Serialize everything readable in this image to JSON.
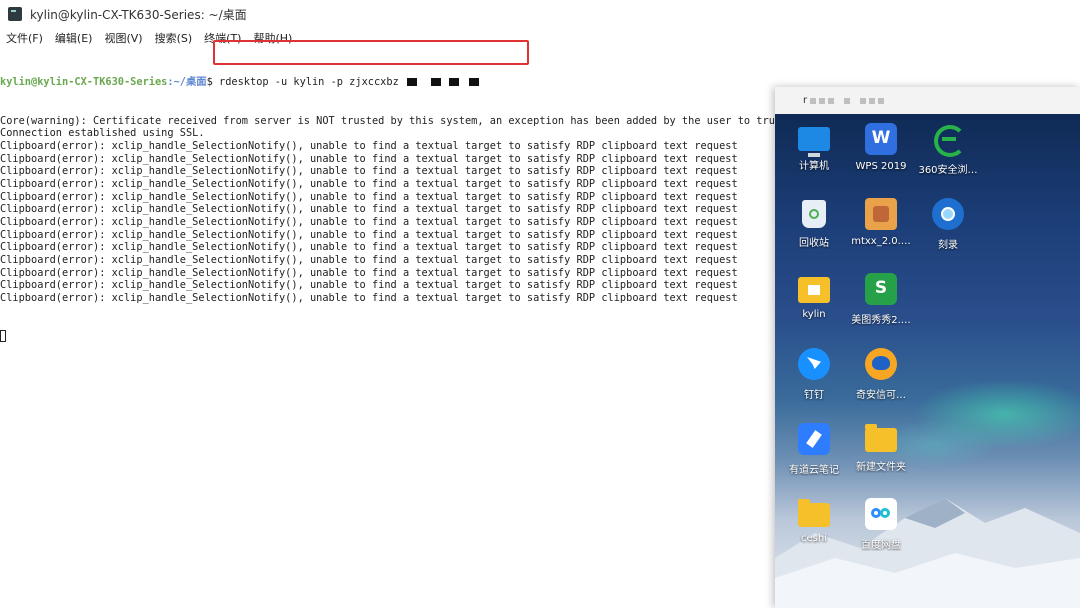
{
  "window": {
    "title": "kylin@kylin-CX-TK630-Series: ~/桌面",
    "menu": [
      "文件(F)",
      "编辑(E)",
      "视图(V)",
      "搜索(S)",
      "终端(T)",
      "帮助(H)"
    ]
  },
  "terminal": {
    "prompt_user": "kylin@kylin-CX-TK630-Series",
    "prompt_path": ":~/桌面",
    "prompt_symbol": "$",
    "command": " rdesktop -u kylin -p zjxccxbz ",
    "command_mask_note": "password partly redacted",
    "lines": [
      "Core(warning): Certificate received from server is NOT trusted by this system, an exception has been added by the user to trust this specific certificate.",
      "Connection established using SSL.",
      "Clipboard(error): xclip_handle_SelectionNotify(), unable to find a textual target to satisfy RDP clipboard text request",
      "Clipboard(error): xclip_handle_SelectionNotify(), unable to find a textual target to satisfy RDP clipboard text request",
      "Clipboard(error): xclip_handle_SelectionNotify(), unable to find a textual target to satisfy RDP clipboard text request",
      "Clipboard(error): xclip_handle_SelectionNotify(), unable to find a textual target to satisfy RDP clipboard text request",
      "Clipboard(error): xclip_handle_SelectionNotify(), unable to find a textual target to satisfy RDP clipboard text request",
      "Clipboard(error): xclip_handle_SelectionNotify(), unable to find a textual target to satisfy RDP clipboard text request",
      "Clipboard(error): xclip_handle_SelectionNotify(), unable to find a textual target to satisfy RDP clipboard text request",
      "Clipboard(error): xclip_handle_SelectionNotify(), unable to find a textual target to satisfy RDP clipboard text request",
      "Clipboard(error): xclip_handle_SelectionNotify(), unable to find a textual target to satisfy RDP clipboard text request",
      "Clipboard(error): xclip_handle_SelectionNotify(), unable to find a textual target to satisfy RDP clipboard text request",
      "Clipboard(error): xclip_handle_SelectionNotify(), unable to find a textual target to satisfy RDP clipboard text request",
      "Clipboard(error): xclip_handle_SelectionNotify(), unable to find a textual target to satisfy RDP clipboard text request",
      "Clipboard(error): xclip_handle_SelectionNotify(), unable to find a textual target to satisfy RDP clipboard text request"
    ]
  },
  "rdp": {
    "title_prefix": "r",
    "icons": [
      {
        "label": "计算机",
        "icon": "computer-icon"
      },
      {
        "label": "WPS 2019",
        "icon": "wps-icon"
      },
      {
        "label": "360安全浏…",
        "icon": "360-browser-icon"
      },
      {
        "label": "回收站",
        "icon": "recycle-bin-icon"
      },
      {
        "label": "mtxx_2.0.…",
        "icon": "mtxx-icon"
      },
      {
        "label": "刻录",
        "icon": "burn-disc-icon"
      },
      {
        "label": "kylin",
        "icon": "home-folder-icon"
      },
      {
        "label": "美图秀秀2.…",
        "icon": "meitu-icon"
      },
      {
        "label": "钉钉",
        "icon": "dingtalk-icon"
      },
      {
        "label": "奇安信可…",
        "icon": "qianxin-icon"
      },
      {
        "label": "有道云笔记",
        "icon": "youdao-note-icon"
      },
      {
        "label": "新建文件夹",
        "icon": "folder-icon"
      },
      {
        "label": "ceshi",
        "icon": "folder-icon"
      },
      {
        "label": "百度网盘",
        "icon": "baidu-netdisk-icon"
      }
    ]
  }
}
